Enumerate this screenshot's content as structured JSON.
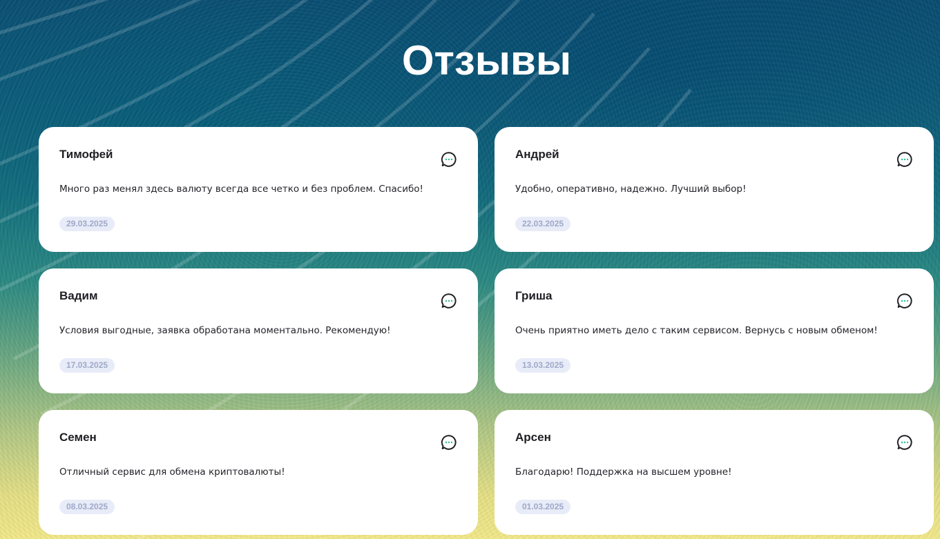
{
  "page": {
    "title": "Отзывы"
  },
  "reviews": [
    {
      "name": "Тимофей",
      "text": "Много раз менял здесь валюту всегда все четко и без проблем. Спасибо!",
      "date": "29.03.2025"
    },
    {
      "name": "Андрей",
      "text": "Удобно, оперативно, надежно. Лучший выбор!",
      "date": "22.03.2025"
    },
    {
      "name": "Вадим",
      "text": "Условия выгодные, заявка обработана моментально. Рекомендую!",
      "date": "17.03.2025"
    },
    {
      "name": "Гриша",
      "text": "Очень приятно иметь дело с таким сервисом. Вернусь с новым обменом!",
      "date": "13.03.2025"
    },
    {
      "name": "Семен",
      "text": "Отличный сервис для обмена криптовалюты!",
      "date": "08.03.2025"
    },
    {
      "name": "Арсен",
      "text": "Благодарю! Поддержка на высшем уровне!",
      "date": "01.03.2025"
    }
  ],
  "icons": {
    "review": "chat-bubble-icon"
  },
  "colors": {
    "accent_dots": "#2fbf8f",
    "date_badge_bg": "#e8ecf8",
    "date_badge_text": "#9fa8c8",
    "card_bg": "#ffffff"
  }
}
